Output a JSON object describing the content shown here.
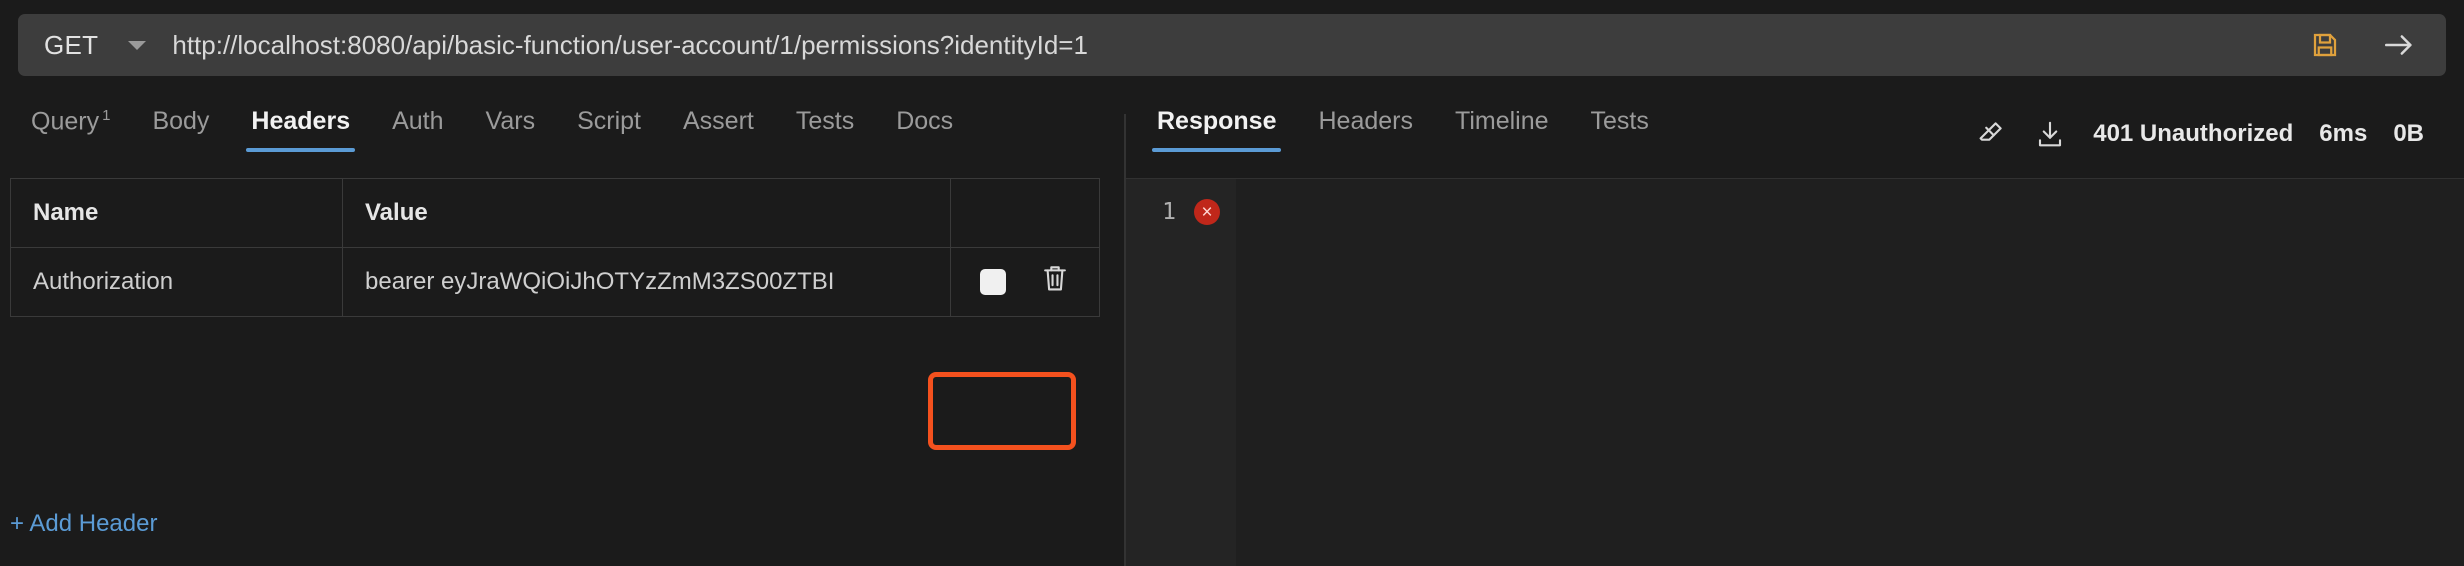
{
  "urlbar": {
    "method": "GET",
    "method_caret_icon": "chevron-down-icon",
    "url": "http://localhost:8080/api/basic-function/user-account/1/permissions?identityId=1",
    "save_icon": "save-disk-icon",
    "send_icon": "arrow-right-icon"
  },
  "request": {
    "tabs": [
      {
        "label": "Query",
        "badge": "1",
        "active": false
      },
      {
        "label": "Body",
        "badge": "",
        "active": false
      },
      {
        "label": "Headers",
        "badge": "",
        "active": true
      },
      {
        "label": "Auth",
        "badge": "",
        "active": false
      },
      {
        "label": "Vars",
        "badge": "",
        "active": false
      },
      {
        "label": "Script",
        "badge": "",
        "active": false
      },
      {
        "label": "Assert",
        "badge": "",
        "active": false
      },
      {
        "label": "Tests",
        "badge": "",
        "active": false
      },
      {
        "label": "Docs",
        "badge": "",
        "active": false
      }
    ],
    "table": {
      "columns": [
        "Name",
        "Value"
      ],
      "rows": [
        {
          "name": "Authorization",
          "value": "bearer eyJraWQiOiJhOTYzZmM3ZS00ZTBI",
          "enabled_checkbox_icon": "checkbox-checked-icon",
          "delete_icon": "trash-icon"
        }
      ]
    },
    "add_header_label": "+ Add Header"
  },
  "response": {
    "tabs": [
      {
        "label": "Response",
        "active": true
      },
      {
        "label": "Headers",
        "active": false
      },
      {
        "label": "Timeline",
        "active": false
      },
      {
        "label": "Tests",
        "active": false
      }
    ],
    "status": {
      "clear_icon": "eraser-icon",
      "download_icon": "download-icon",
      "code_text": "401 Unauthorized",
      "time": "6ms",
      "size": "0B"
    },
    "body": {
      "line_number": "1",
      "error_marker_icon": "error-circle-icon",
      "error_marker_glyph": "×",
      "content": ""
    }
  },
  "colors": {
    "accent_blue": "#5b9bd5",
    "highlight_orange": "#f4511e",
    "error_red": "#c0271a",
    "bg": "#1b1b1b",
    "urlbar_bg": "#3d3d3d"
  }
}
